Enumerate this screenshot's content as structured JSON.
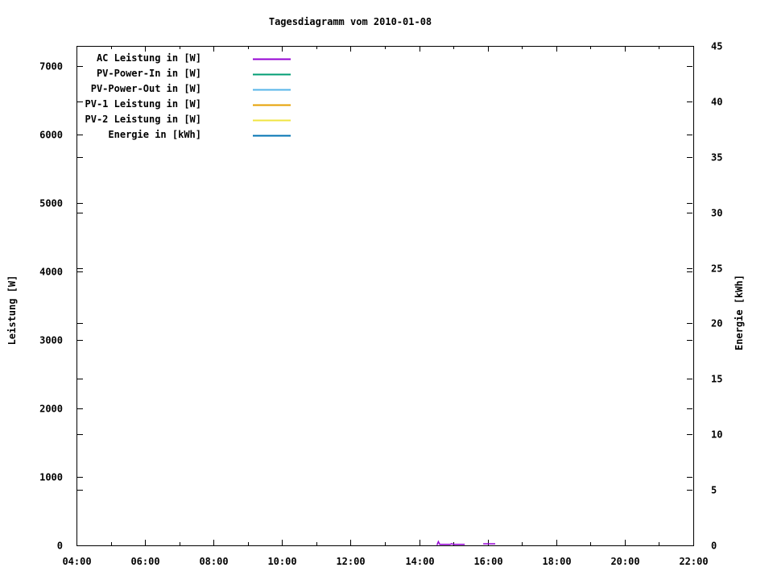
{
  "window": {
    "background": "#ffffff",
    "foreground": "#000000"
  },
  "chart_data": {
    "type": "line",
    "title": "Tagesdiagramm vom 2010-01-08",
    "xlabel": "",
    "ylabel": "Leistung [W]",
    "y2label": "Energie [kWh]",
    "grid": false,
    "legend_position": "top-left-inside",
    "x_axis": {
      "unit": "time-of-day",
      "lim_hours": [
        4,
        22
      ],
      "major_tick_hours": [
        4,
        6,
        8,
        10,
        12,
        14,
        16,
        18,
        20,
        22
      ],
      "major_tick_labels": [
        "04:00",
        "06:00",
        "08:00",
        "10:00",
        "12:00",
        "14:00",
        "16:00",
        "18:00",
        "20:00",
        "22:00"
      ],
      "minor_tick_hours": [
        5,
        7,
        9,
        11,
        13,
        15,
        17,
        19,
        21
      ]
    },
    "y_axis": {
      "lim": [
        0,
        7294
      ],
      "ticks": [
        0,
        1000,
        2000,
        3000,
        4000,
        5000,
        6000,
        7000
      ],
      "tick_labels": [
        "0",
        "1000",
        "2000",
        "3000",
        "4000",
        "5000",
        "6000",
        "7000"
      ]
    },
    "y2_axis": {
      "lim": [
        0,
        45
      ],
      "ticks": [
        0,
        5,
        10,
        15,
        20,
        25,
        30,
        35,
        40,
        45
      ],
      "tick_labels": [
        "0",
        "5",
        "10",
        "15",
        "20",
        "25",
        "30",
        "35",
        "40",
        "45"
      ]
    },
    "legend": {
      "entries": [
        {
          "label": "AC Leistung in [W]",
          "color": "#9400d3"
        },
        {
          "label": "PV-Power-In in [W]",
          "color": "#009e73"
        },
        {
          "label": "PV-Power-Out in [W]",
          "color": "#56b4e9"
        },
        {
          "label": "PV-1 Leistung in [W]",
          "color": "#e69f00"
        },
        {
          "label": "PV-2 Leistung in [W]",
          "color": "#f0e442"
        },
        {
          "label": "Energie in [kWh]",
          "color": "#0072b2"
        }
      ]
    },
    "series": [
      {
        "name": "AC Leistung in [W]",
        "color": "#9400d3",
        "axis": "y",
        "segments": [
          [
            [
              14.52,
              5
            ],
            [
              14.56,
              55
            ],
            [
              14.6,
              14
            ],
            [
              14.9,
              14
            ],
            [
              14.95,
              25
            ],
            [
              15.0,
              14
            ],
            [
              15.33,
              14
            ]
          ],
          [
            [
              15.87,
              22
            ],
            [
              16.22,
              22
            ]
          ]
        ]
      },
      {
        "name": "PV-Power-In in [W]",
        "color": "#009e73",
        "axis": "y",
        "segments": []
      },
      {
        "name": "PV-Power-Out in [W]",
        "color": "#56b4e9",
        "axis": "y",
        "segments": []
      },
      {
        "name": "PV-1 Leistung in [W]",
        "color": "#e69f00",
        "axis": "y",
        "segments": []
      },
      {
        "name": "PV-2 Leistung in [W]",
        "color": "#f0e442",
        "axis": "y",
        "segments": []
      },
      {
        "name": "Energie in [kWh]",
        "color": "#0072b2",
        "axis": "y2",
        "segments": []
      }
    ],
    "note": "Only the AC Leistung series shows visible data: two tiny segments just above 0 W between about 14:30-15:20 and 15:50-16:15 (peak about 55 W). All other series show no visible points; axes otherwise empty."
  }
}
